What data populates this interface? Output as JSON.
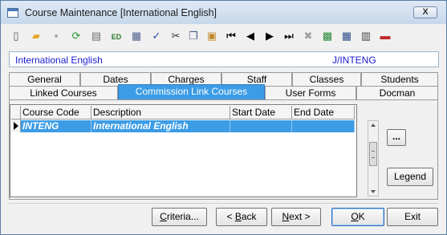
{
  "window": {
    "title": "Course Maintenance  [International English]",
    "close_label": "X"
  },
  "toolbar": {
    "buttons": [
      {
        "name": "new-icon",
        "glyph": "▯",
        "color": "#555555"
      },
      {
        "name": "open-folder-icon",
        "glyph": "▰",
        "color": "#e3a72a"
      },
      {
        "name": "save-icon",
        "glyph": "▪",
        "color": "#9aa0a8"
      },
      {
        "name": "refresh-icon",
        "glyph": "⟳",
        "color": "#2f9a2f"
      },
      {
        "name": "print-icon",
        "glyph": "▤",
        "color": "#6d6d6d"
      },
      {
        "name": "edit-icon",
        "glyph": "ED",
        "color": "#2a7a2a"
      },
      {
        "name": "calculator-icon",
        "glyph": "▦",
        "color": "#4a5e8a"
      },
      {
        "name": "spellcheck-icon",
        "glyph": "✓",
        "color": "#2a4aa8"
      },
      {
        "name": "cut-icon",
        "glyph": "✂",
        "color": "#333333"
      },
      {
        "name": "copy-icon",
        "glyph": "❐",
        "color": "#4a5e8a"
      },
      {
        "name": "paste-icon",
        "glyph": "▣",
        "color": "#c08a2a"
      },
      {
        "name": "first-record-icon",
        "glyph": "⏮",
        "color": "#000000"
      },
      {
        "name": "previous-record-icon",
        "glyph": "◀",
        "color": "#000000"
      },
      {
        "name": "next-record-icon",
        "glyph": "▶",
        "color": "#000000"
      },
      {
        "name": "last-record-icon",
        "glyph": "⏭",
        "color": "#000000"
      },
      {
        "name": "delete-icon",
        "glyph": "✖",
        "color": "#a0a0a0"
      },
      {
        "name": "grid-tool-icon",
        "glyph": "▩",
        "color": "#2a8a3a"
      },
      {
        "name": "table-tool-icon",
        "glyph": "▦",
        "color": "#2a4a8a"
      },
      {
        "name": "film-icon",
        "glyph": "▥",
        "color": "#444444"
      },
      {
        "name": "delete-record-icon",
        "glyph": "▬",
        "color": "#c02a2a"
      }
    ]
  },
  "infobar": {
    "course_name": "International English",
    "course_code": "J/INTENG"
  },
  "tabs": {
    "row1": [
      "General",
      "Dates",
      "Charges",
      "Staff",
      "Classes",
      "Students"
    ],
    "row2": [
      "Linked Courses",
      "Commission Link Courses",
      "User Forms",
      "Docman"
    ],
    "active": "Commission Link Courses"
  },
  "grid": {
    "columns": [
      "Course Code",
      "Description",
      "Start Date",
      "End Date"
    ],
    "rows": [
      {
        "code": "INTENG",
        "description": "International English",
        "start": "",
        "end": ""
      }
    ]
  },
  "side_buttons": {
    "ellipsis": "...",
    "legend": "Legend"
  },
  "footer_buttons": {
    "criteria": "Criteria...",
    "back": "< Back",
    "next": "Next >",
    "ok": "OK",
    "exit": "Exit"
  }
}
